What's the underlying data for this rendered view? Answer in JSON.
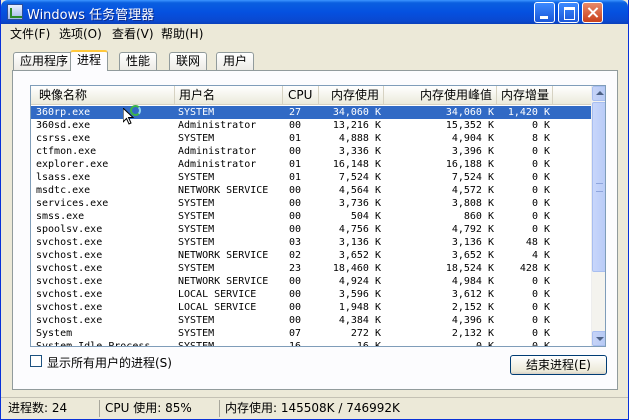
{
  "window": {
    "title": "Windows 任务管理器"
  },
  "menu": [
    {
      "label": "文件(F)"
    },
    {
      "label": "选项(O)"
    },
    {
      "label": "查看(V)"
    },
    {
      "label": "帮助(H)"
    }
  ],
  "tabs": [
    {
      "label": "应用程序",
      "active": false
    },
    {
      "label": "进程",
      "active": true
    },
    {
      "label": "性能",
      "active": false
    },
    {
      "label": "联网",
      "active": false
    },
    {
      "label": "用户",
      "active": false
    }
  ],
  "table": {
    "headers": [
      "映像名称",
      "用户名",
      "CPU",
      "内存使用",
      "内存使用峰值",
      "内存增量"
    ],
    "selected_row": 0,
    "rows": [
      [
        "360rp.exe",
        "SYSTEM",
        "27",
        "34,060 K",
        "34,060 K",
        "1,420 K"
      ],
      [
        "360sd.exe",
        "Administrator",
        "00",
        "13,216 K",
        "15,352 K",
        "0 K"
      ],
      [
        "csrss.exe",
        "SYSTEM",
        "01",
        "4,888 K",
        "4,904 K",
        "8 K"
      ],
      [
        "ctfmon.exe",
        "Administrator",
        "00",
        "3,336 K",
        "3,396 K",
        "0 K"
      ],
      [
        "explorer.exe",
        "Administrator",
        "01",
        "16,148 K",
        "16,188 K",
        "0 K"
      ],
      [
        "lsass.exe",
        "SYSTEM",
        "01",
        "7,524 K",
        "7,524 K",
        "0 K"
      ],
      [
        "msdtc.exe",
        "NETWORK SERVICE",
        "00",
        "4,564 K",
        "4,572 K",
        "0 K"
      ],
      [
        "services.exe",
        "SYSTEM",
        "00",
        "3,736 K",
        "3,808 K",
        "0 K"
      ],
      [
        "smss.exe",
        "SYSTEM",
        "00",
        "504 K",
        "860 K",
        "0 K"
      ],
      [
        "spoolsv.exe",
        "SYSTEM",
        "00",
        "4,756 K",
        "4,792 K",
        "0 K"
      ],
      [
        "svchost.exe",
        "SYSTEM",
        "03",
        "3,136 K",
        "3,136 K",
        "48 K"
      ],
      [
        "svchost.exe",
        "NETWORK SERVICE",
        "02",
        "3,652 K",
        "3,652 K",
        "4 K"
      ],
      [
        "svchost.exe",
        "SYSTEM",
        "23",
        "18,460 K",
        "18,524 K",
        "428 K"
      ],
      [
        "svchost.exe",
        "NETWORK SERVICE",
        "00",
        "4,924 K",
        "4,984 K",
        "0 K"
      ],
      [
        "svchost.exe",
        "LOCAL SERVICE",
        "00",
        "3,596 K",
        "3,612 K",
        "0 K"
      ],
      [
        "svchost.exe",
        "LOCAL SERVICE",
        "00",
        "1,948 K",
        "2,152 K",
        "0 K"
      ],
      [
        "svchost.exe",
        "SYSTEM",
        "00",
        "4,384 K",
        "4,396 K",
        "0 K"
      ],
      [
        "System",
        "SYSTEM",
        "07",
        "272 K",
        "2,132 K",
        "0 K"
      ],
      [
        "System Idle Process",
        "SYSTEM",
        "16",
        "16 K",
        "0 K",
        "0 K"
      ]
    ]
  },
  "show_all_users": {
    "label": "显示所有用户的进程(S)",
    "checked": false
  },
  "end_process_button": "结束进程(E)",
  "status": {
    "processes": "进程数: 24",
    "cpu": "CPU 使用: 85%",
    "memory": "内存使用: 145508K / 746992K"
  },
  "colors": {
    "selection": "#316ac5",
    "titlebar": "#0551e0",
    "face": "#ece9d8"
  }
}
